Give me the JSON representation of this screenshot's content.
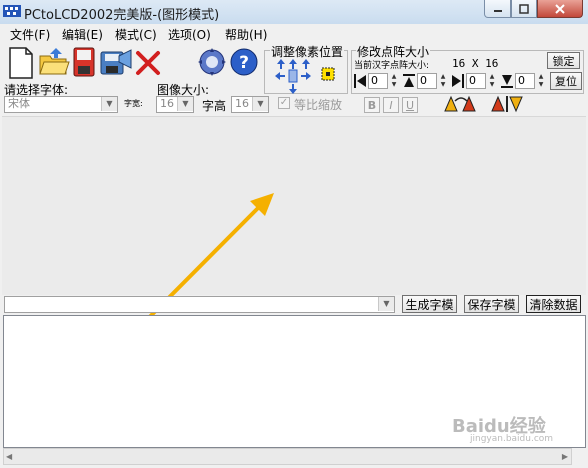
{
  "window": {
    "title": "PCtoLCD2002完美版-(图形模式)"
  },
  "menu": [
    "文件(F)",
    "编辑(E)",
    "模式(C)",
    "选项(O)",
    "帮助(H)"
  ],
  "font_select": {
    "label": "请选择字体:",
    "value": "宋体"
  },
  "font_width": {
    "label": "字宽:",
    "value": "16"
  },
  "image_size": {
    "label": "图像大小:"
  },
  "font_height": {
    "label": "字高",
    "value": "16"
  },
  "proportional": {
    "label": "等比缩放"
  },
  "format_buttons": [
    "B",
    "I",
    "U"
  ],
  "adjust_group": {
    "title": "调整像素位置"
  },
  "resize_group": {
    "title": "修改点阵大小",
    "current_label": "当前汉字点阵大小:",
    "current_value": "16 X 16",
    "spin_values": [
      "0",
      "0",
      "0",
      "0"
    ],
    "lock_label": "锁定",
    "reset_label": "复位"
  },
  "actions": {
    "generate": "生成字模",
    "save": "保存字模",
    "clear": "清除数据"
  },
  "watermark": {
    "text": "Baidu经验",
    "sub": "jingyan.baidu.com"
  },
  "colors": {
    "accent": "#f5b000",
    "titlebar": "#c9dcef",
    "close": "#c2483a"
  }
}
